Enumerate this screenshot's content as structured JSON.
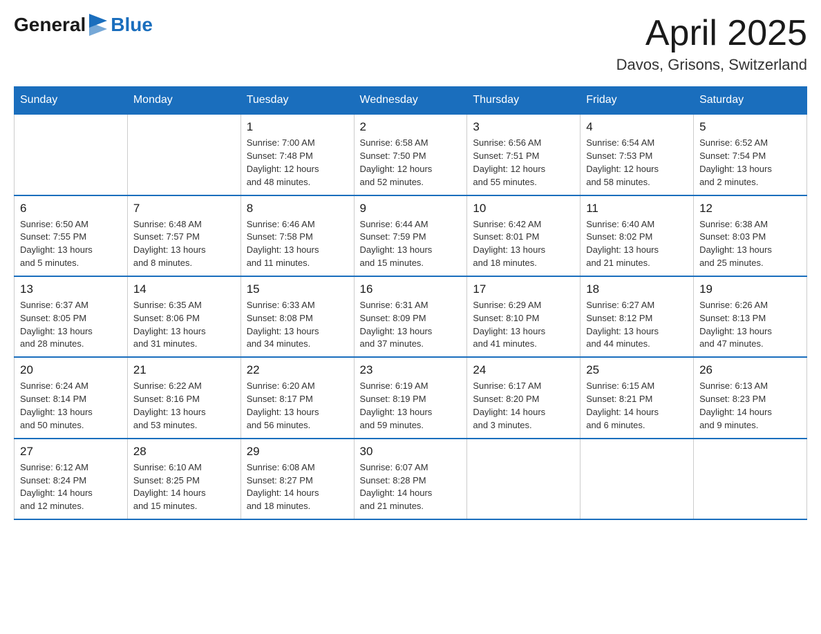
{
  "header": {
    "logo_general": "General",
    "logo_blue": "Blue",
    "month_title": "April 2025",
    "location": "Davos, Grisons, Switzerland"
  },
  "days_of_week": [
    "Sunday",
    "Monday",
    "Tuesday",
    "Wednesday",
    "Thursday",
    "Friday",
    "Saturday"
  ],
  "weeks": [
    [
      {
        "day": "",
        "info": ""
      },
      {
        "day": "",
        "info": ""
      },
      {
        "day": "1",
        "info": "Sunrise: 7:00 AM\nSunset: 7:48 PM\nDaylight: 12 hours\nand 48 minutes."
      },
      {
        "day": "2",
        "info": "Sunrise: 6:58 AM\nSunset: 7:50 PM\nDaylight: 12 hours\nand 52 minutes."
      },
      {
        "day": "3",
        "info": "Sunrise: 6:56 AM\nSunset: 7:51 PM\nDaylight: 12 hours\nand 55 minutes."
      },
      {
        "day": "4",
        "info": "Sunrise: 6:54 AM\nSunset: 7:53 PM\nDaylight: 12 hours\nand 58 minutes."
      },
      {
        "day": "5",
        "info": "Sunrise: 6:52 AM\nSunset: 7:54 PM\nDaylight: 13 hours\nand 2 minutes."
      }
    ],
    [
      {
        "day": "6",
        "info": "Sunrise: 6:50 AM\nSunset: 7:55 PM\nDaylight: 13 hours\nand 5 minutes."
      },
      {
        "day": "7",
        "info": "Sunrise: 6:48 AM\nSunset: 7:57 PM\nDaylight: 13 hours\nand 8 minutes."
      },
      {
        "day": "8",
        "info": "Sunrise: 6:46 AM\nSunset: 7:58 PM\nDaylight: 13 hours\nand 11 minutes."
      },
      {
        "day": "9",
        "info": "Sunrise: 6:44 AM\nSunset: 7:59 PM\nDaylight: 13 hours\nand 15 minutes."
      },
      {
        "day": "10",
        "info": "Sunrise: 6:42 AM\nSunset: 8:01 PM\nDaylight: 13 hours\nand 18 minutes."
      },
      {
        "day": "11",
        "info": "Sunrise: 6:40 AM\nSunset: 8:02 PM\nDaylight: 13 hours\nand 21 minutes."
      },
      {
        "day": "12",
        "info": "Sunrise: 6:38 AM\nSunset: 8:03 PM\nDaylight: 13 hours\nand 25 minutes."
      }
    ],
    [
      {
        "day": "13",
        "info": "Sunrise: 6:37 AM\nSunset: 8:05 PM\nDaylight: 13 hours\nand 28 minutes."
      },
      {
        "day": "14",
        "info": "Sunrise: 6:35 AM\nSunset: 8:06 PM\nDaylight: 13 hours\nand 31 minutes."
      },
      {
        "day": "15",
        "info": "Sunrise: 6:33 AM\nSunset: 8:08 PM\nDaylight: 13 hours\nand 34 minutes."
      },
      {
        "day": "16",
        "info": "Sunrise: 6:31 AM\nSunset: 8:09 PM\nDaylight: 13 hours\nand 37 minutes."
      },
      {
        "day": "17",
        "info": "Sunrise: 6:29 AM\nSunset: 8:10 PM\nDaylight: 13 hours\nand 41 minutes."
      },
      {
        "day": "18",
        "info": "Sunrise: 6:27 AM\nSunset: 8:12 PM\nDaylight: 13 hours\nand 44 minutes."
      },
      {
        "day": "19",
        "info": "Sunrise: 6:26 AM\nSunset: 8:13 PM\nDaylight: 13 hours\nand 47 minutes."
      }
    ],
    [
      {
        "day": "20",
        "info": "Sunrise: 6:24 AM\nSunset: 8:14 PM\nDaylight: 13 hours\nand 50 minutes."
      },
      {
        "day": "21",
        "info": "Sunrise: 6:22 AM\nSunset: 8:16 PM\nDaylight: 13 hours\nand 53 minutes."
      },
      {
        "day": "22",
        "info": "Sunrise: 6:20 AM\nSunset: 8:17 PM\nDaylight: 13 hours\nand 56 minutes."
      },
      {
        "day": "23",
        "info": "Sunrise: 6:19 AM\nSunset: 8:19 PM\nDaylight: 13 hours\nand 59 minutes."
      },
      {
        "day": "24",
        "info": "Sunrise: 6:17 AM\nSunset: 8:20 PM\nDaylight: 14 hours\nand 3 minutes."
      },
      {
        "day": "25",
        "info": "Sunrise: 6:15 AM\nSunset: 8:21 PM\nDaylight: 14 hours\nand 6 minutes."
      },
      {
        "day": "26",
        "info": "Sunrise: 6:13 AM\nSunset: 8:23 PM\nDaylight: 14 hours\nand 9 minutes."
      }
    ],
    [
      {
        "day": "27",
        "info": "Sunrise: 6:12 AM\nSunset: 8:24 PM\nDaylight: 14 hours\nand 12 minutes."
      },
      {
        "day": "28",
        "info": "Sunrise: 6:10 AM\nSunset: 8:25 PM\nDaylight: 14 hours\nand 15 minutes."
      },
      {
        "day": "29",
        "info": "Sunrise: 6:08 AM\nSunset: 8:27 PM\nDaylight: 14 hours\nand 18 minutes."
      },
      {
        "day": "30",
        "info": "Sunrise: 6:07 AM\nSunset: 8:28 PM\nDaylight: 14 hours\nand 21 minutes."
      },
      {
        "day": "",
        "info": ""
      },
      {
        "day": "",
        "info": ""
      },
      {
        "day": "",
        "info": ""
      }
    ]
  ]
}
